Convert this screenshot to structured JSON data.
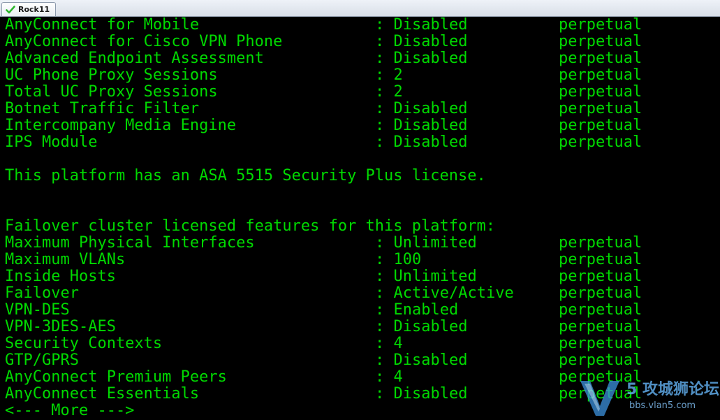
{
  "tab": {
    "label": "Rock11",
    "icon": "checkmark-icon",
    "icon_color": "#2db52d"
  },
  "terminal": {
    "text_color": "#00d900",
    "background": "#000000",
    "feature_rows_top": [
      {
        "name": "AnyConnect for Mobile",
        "sep": ":",
        "value": "Disabled",
        "term": "perpetual"
      },
      {
        "name": "AnyConnect for Cisco VPN Phone",
        "sep": ":",
        "value": "Disabled",
        "term": "perpetual"
      },
      {
        "name": "Advanced Endpoint Assessment",
        "sep": ":",
        "value": "Disabled",
        "term": "perpetual"
      },
      {
        "name": "UC Phone Proxy Sessions",
        "sep": ":",
        "value": "2",
        "term": "perpetual"
      },
      {
        "name": "Total UC Proxy Sessions",
        "sep": ":",
        "value": "2",
        "term": "perpetual"
      },
      {
        "name": "Botnet Traffic Filter",
        "sep": ":",
        "value": "Disabled",
        "term": "perpetual"
      },
      {
        "name": "Intercompany Media Engine",
        "sep": ":",
        "value": "Disabled",
        "term": "perpetual"
      },
      {
        "name": "IPS Module",
        "sep": ":",
        "value": "Disabled",
        "term": "perpetual"
      }
    ],
    "platform_line": "This platform has an ASA 5515 Security Plus license.",
    "failover_header": "Failover cluster licensed features for this platform:",
    "feature_rows_failover": [
      {
        "name": "Maximum Physical Interfaces",
        "sep": ":",
        "value": "Unlimited",
        "term": "perpetual"
      },
      {
        "name": "Maximum VLANs",
        "sep": ":",
        "value": "100",
        "term": "perpetual"
      },
      {
        "name": "Inside Hosts",
        "sep": ":",
        "value": "Unlimited",
        "term": "perpetual"
      },
      {
        "name": "Failover",
        "sep": ":",
        "value": "Active/Active",
        "term": "perpetual"
      },
      {
        "name": "VPN-DES",
        "sep": ":",
        "value": "Enabled",
        "term": "perpetual"
      },
      {
        "name": "VPN-3DES-AES",
        "sep": ":",
        "value": "Disabled",
        "term": "perpetual"
      },
      {
        "name": "Security Contexts",
        "sep": ":",
        "value": "4",
        "term": "perpetual"
      },
      {
        "name": "GTP/GPRS",
        "sep": ":",
        "value": "Disabled",
        "term": "perpetual"
      },
      {
        "name": "AnyConnect Premium Peers",
        "sep": ":",
        "value": "4",
        "term": "perpetual"
      },
      {
        "name": "AnyConnect Essentials",
        "sep": ":",
        "value": "Disabled",
        "term": "perpetual"
      }
    ],
    "more_prompt": "<--- More --->"
  },
  "watermark": {
    "title": "5 攻城狮论坛",
    "url": "bbs.vlan5.com",
    "color": "#5ea9e6"
  }
}
